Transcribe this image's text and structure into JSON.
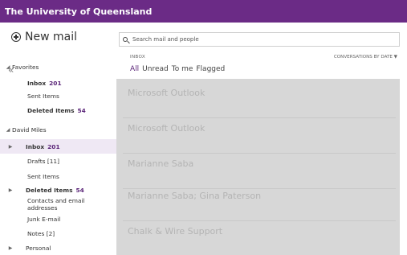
{
  "topbar": {
    "title": "The University of Queensland"
  },
  "left": {
    "new_mail": "New mail",
    "collapse": "«",
    "folders": [
      {
        "label": "Favorites",
        "count": "",
        "level": "header"
      },
      {
        "label": "Inbox",
        "count": "201",
        "level": "item",
        "bold": true
      },
      {
        "label": "Sent Items",
        "count": "",
        "level": "item"
      },
      {
        "label": "Deleted Items",
        "count": "54",
        "level": "item",
        "bold": true
      },
      {
        "label": "David Miles",
        "count": "",
        "level": "header"
      },
      {
        "label": "Inbox",
        "count": "201",
        "level": "item",
        "bold": true,
        "selected": true,
        "expander": true
      },
      {
        "label": "Drafts [11]",
        "count": "",
        "level": "item"
      },
      {
        "label": "Sent Items",
        "count": "",
        "level": "item"
      },
      {
        "label": "Deleted Items",
        "count": "54",
        "level": "item",
        "bold": true,
        "expander": true
      },
      {
        "label": "Contacts and email addresses",
        "count": "",
        "level": "item"
      },
      {
        "label": "Junk E-mail",
        "count": "",
        "level": "item"
      },
      {
        "label": "Notes [2]",
        "count": "",
        "level": "item"
      },
      {
        "label": "Personal",
        "count": "",
        "level": "item",
        "expander": true
      }
    ]
  },
  "center": {
    "search_placeholder": "Search mail and people",
    "inbox_label": "INBOX",
    "sort_label": "CONVERSATIONS BY DATE ▼",
    "tabs": [
      "All",
      "Unread",
      "To me",
      "Flagged"
    ]
  },
  "messages": [
    {
      "sender": "Microsoft Outlook",
      "subject": "",
      "preview": "",
      "time": ""
    },
    {
      "sender": "Microsoft Outlook",
      "subject": "",
      "preview": "",
      "time": ""
    },
    {
      "sender": "Marianne Saba",
      "subject": "",
      "preview": "",
      "time": ""
    },
    {
      "sender": "Marianne Saba; Gina Paterson",
      "subject": "",
      "preview": "",
      "time": ""
    },
    {
      "sender": "Chalk & Wire Support",
      "subject": "",
      "preview": "",
      "time": ""
    }
  ]
}
